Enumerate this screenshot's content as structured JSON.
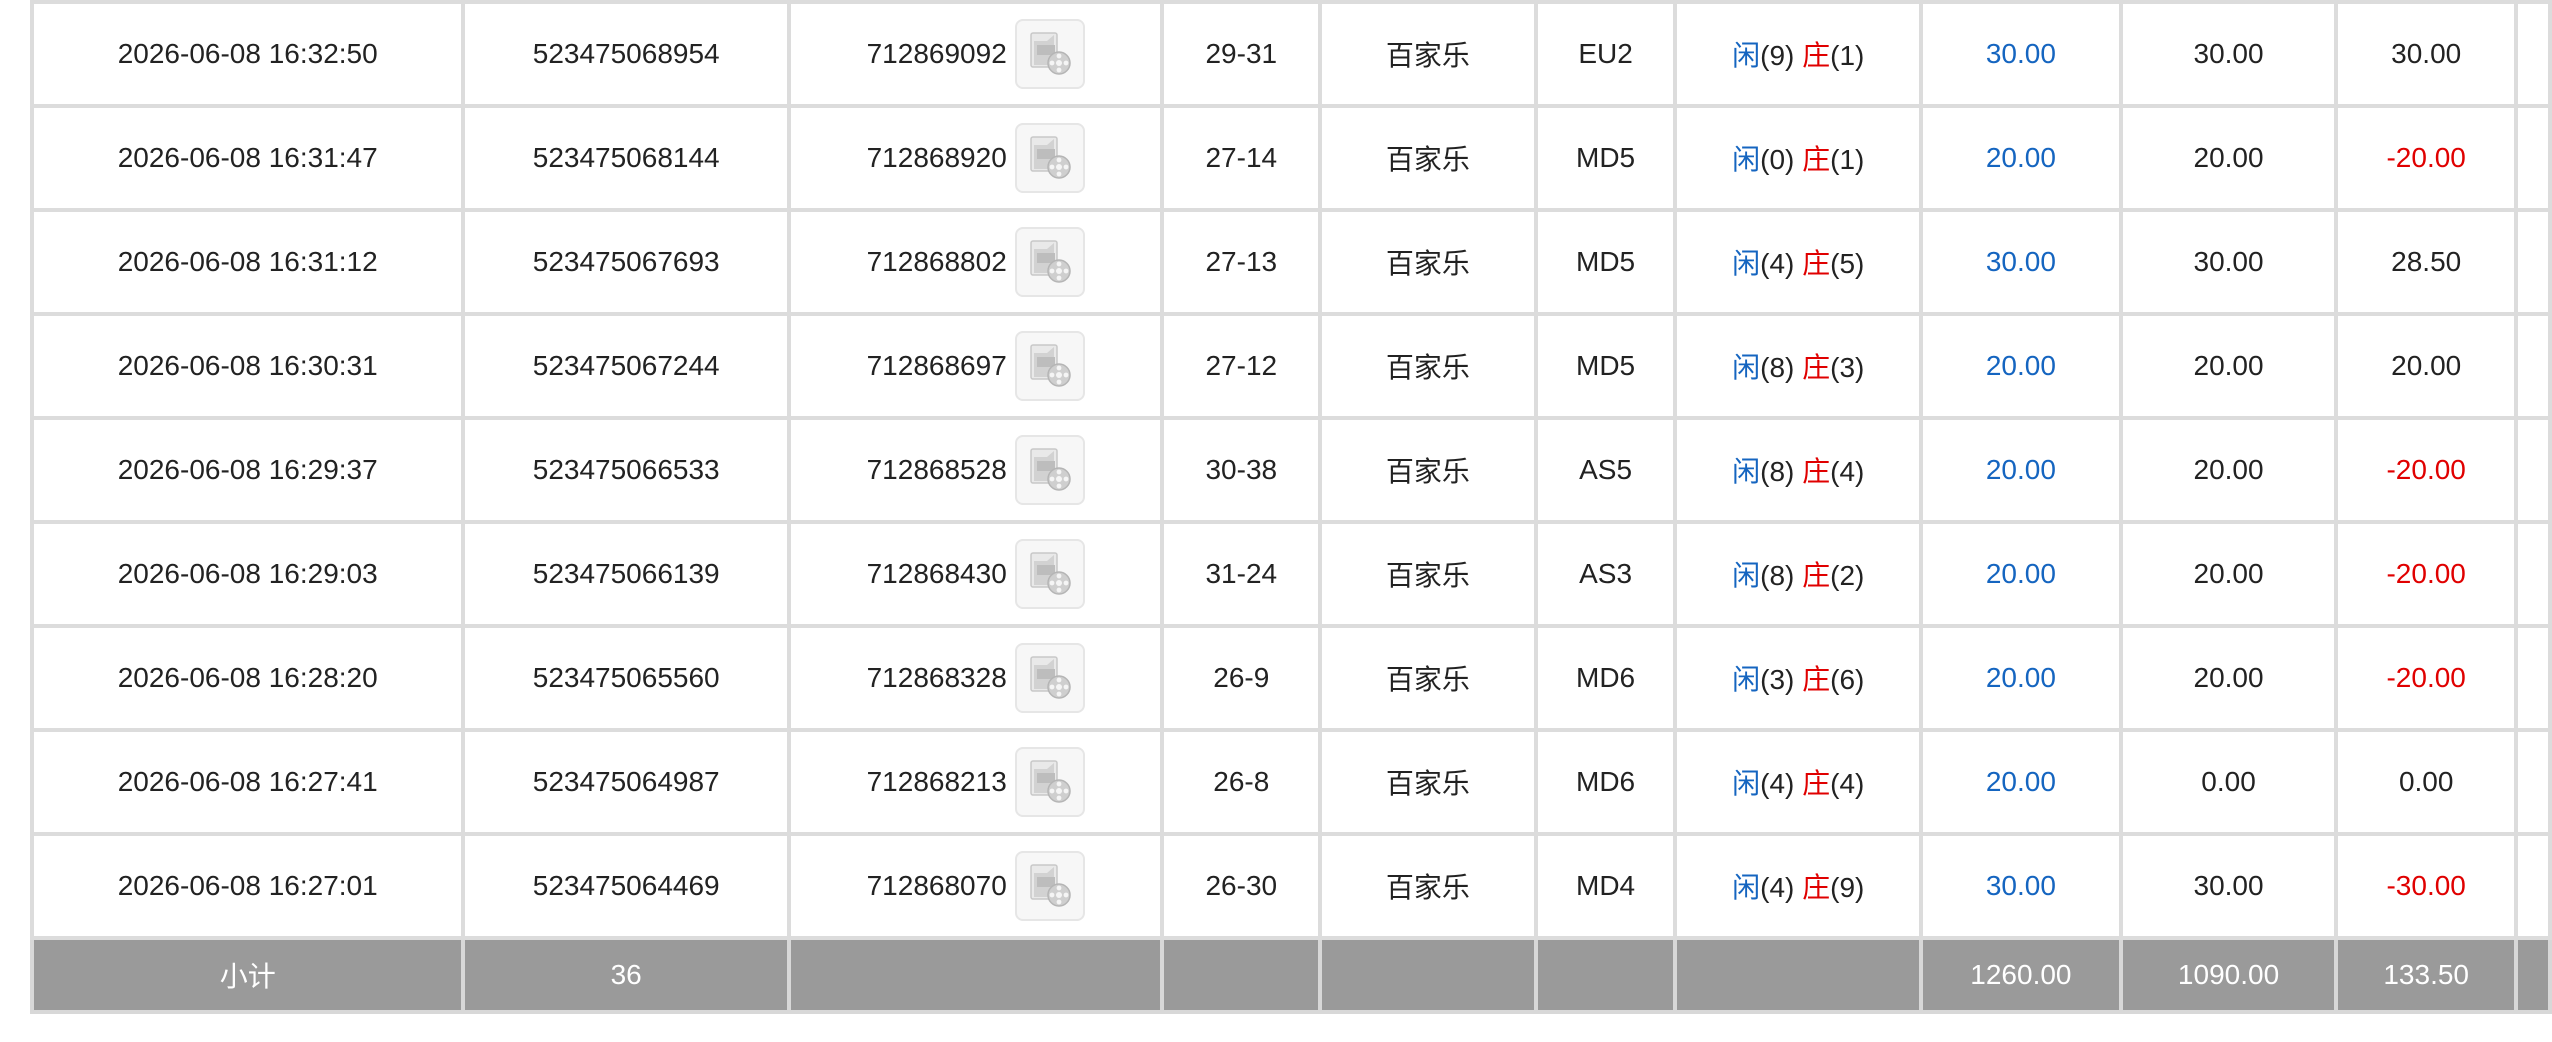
{
  "rows": [
    {
      "time": "2026-06-08 16:32:50",
      "bet_id": "523475068954",
      "round_id": "712869092",
      "shoe": "29-31",
      "game": "百家乐",
      "table": "EU2",
      "player_label": "闲",
      "player_score": "(9)",
      "banker_label": "庄",
      "banker_score": "(1)",
      "bet_amount": "30.00",
      "valid_bet": "30.00",
      "win_loss": "30.00",
      "win_loss_negative": false
    },
    {
      "time": "2026-06-08 16:31:47",
      "bet_id": "523475068144",
      "round_id": "712868920",
      "shoe": "27-14",
      "game": "百家乐",
      "table": "MD5",
      "player_label": "闲",
      "player_score": "(0)",
      "banker_label": "庄",
      "banker_score": "(1)",
      "bet_amount": "20.00",
      "valid_bet": "20.00",
      "win_loss": "-20.00",
      "win_loss_negative": true
    },
    {
      "time": "2026-06-08 16:31:12",
      "bet_id": "523475067693",
      "round_id": "712868802",
      "shoe": "27-13",
      "game": "百家乐",
      "table": "MD5",
      "player_label": "闲",
      "player_score": "(4)",
      "banker_label": "庄",
      "banker_score": "(5)",
      "bet_amount": "30.00",
      "valid_bet": "30.00",
      "win_loss": "28.50",
      "win_loss_negative": false
    },
    {
      "time": "2026-06-08 16:30:31",
      "bet_id": "523475067244",
      "round_id": "712868697",
      "shoe": "27-12",
      "game": "百家乐",
      "table": "MD5",
      "player_label": "闲",
      "player_score": "(8)",
      "banker_label": "庄",
      "banker_score": "(3)",
      "bet_amount": "20.00",
      "valid_bet": "20.00",
      "win_loss": "20.00",
      "win_loss_negative": false
    },
    {
      "time": "2026-06-08 16:29:37",
      "bet_id": "523475066533",
      "round_id": "712868528",
      "shoe": "30-38",
      "game": "百家乐",
      "table": "AS5",
      "player_label": "闲",
      "player_score": "(8)",
      "banker_label": "庄",
      "banker_score": "(4)",
      "bet_amount": "20.00",
      "valid_bet": "20.00",
      "win_loss": "-20.00",
      "win_loss_negative": true
    },
    {
      "time": "2026-06-08 16:29:03",
      "bet_id": "523475066139",
      "round_id": "712868430",
      "shoe": "31-24",
      "game": "百家乐",
      "table": "AS3",
      "player_label": "闲",
      "player_score": "(8)",
      "banker_label": "庄",
      "banker_score": "(2)",
      "bet_amount": "20.00",
      "valid_bet": "20.00",
      "win_loss": "-20.00",
      "win_loss_negative": true
    },
    {
      "time": "2026-06-08 16:28:20",
      "bet_id": "523475065560",
      "round_id": "712868328",
      "shoe": "26-9",
      "game": "百家乐",
      "table": "MD6",
      "player_label": "闲",
      "player_score": "(3)",
      "banker_label": "庄",
      "banker_score": "(6)",
      "bet_amount": "20.00",
      "valid_bet": "20.00",
      "win_loss": "-20.00",
      "win_loss_negative": true
    },
    {
      "time": "2026-06-08 16:27:41",
      "bet_id": "523475064987",
      "round_id": "712868213",
      "shoe": "26-8",
      "game": "百家乐",
      "table": "MD6",
      "player_label": "闲",
      "player_score": "(4)",
      "banker_label": "庄",
      "banker_score": "(4)",
      "bet_amount": "20.00",
      "valid_bet": "0.00",
      "win_loss": "0.00",
      "win_loss_negative": false
    },
    {
      "time": "2026-06-08 16:27:01",
      "bet_id": "523475064469",
      "round_id": "712868070",
      "shoe": "26-30",
      "game": "百家乐",
      "table": "MD4",
      "player_label": "闲",
      "player_score": "(4)",
      "banker_label": "庄",
      "banker_score": "(9)",
      "bet_amount": "30.00",
      "valid_bet": "30.00",
      "win_loss": "-30.00",
      "win_loss_negative": true
    }
  ],
  "subtotal": {
    "label": "小计",
    "count": "36",
    "bet_amount": "1260.00",
    "valid_bet": "1090.00",
    "win_loss": "133.50"
  },
  "icons": {
    "replay": "video-replay-icon"
  },
  "colors": {
    "player": "#1565c0",
    "banker": "#e00000",
    "negative": "#e00000",
    "subtotal_bg": "#9a9a9a",
    "grid": "#dcdcdc"
  }
}
